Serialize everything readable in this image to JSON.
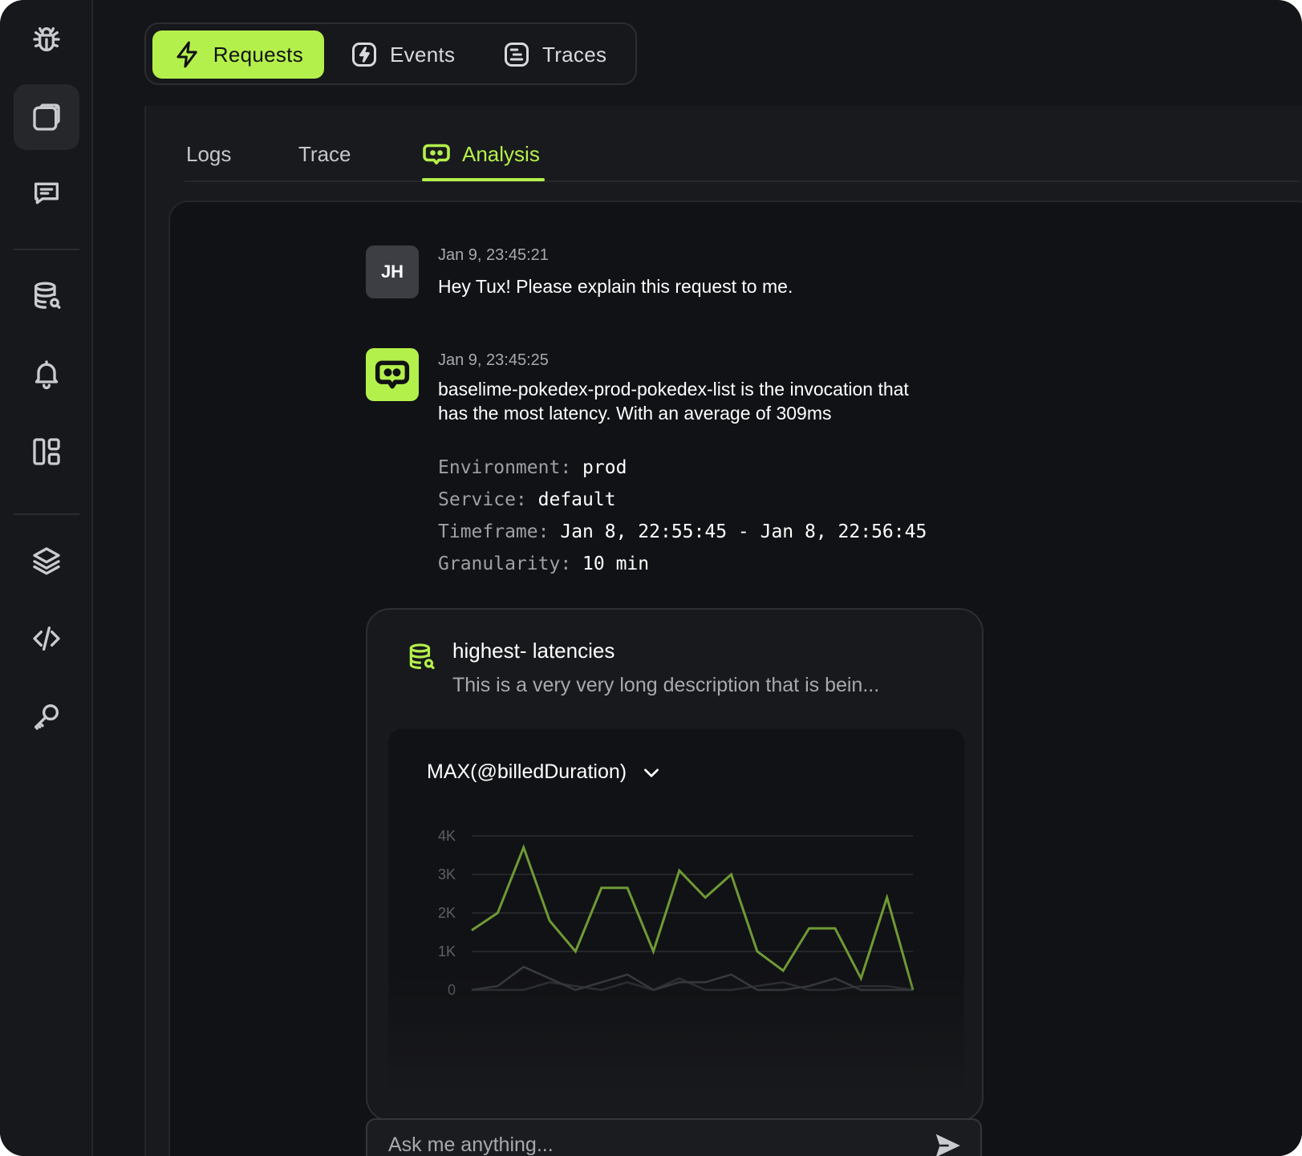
{
  "top_tabs": [
    {
      "label": "Requests",
      "icon": "lightning-icon",
      "active": true
    },
    {
      "label": "Events",
      "icon": "bolt-square-icon",
      "active": false
    },
    {
      "label": "Traces",
      "icon": "list-square-icon",
      "active": false
    }
  ],
  "sub_tabs": [
    {
      "label": "Logs",
      "active": false
    },
    {
      "label": "Trace",
      "active": false
    },
    {
      "label": "Analysis",
      "active": true,
      "icon": "bot-icon"
    }
  ],
  "sidebar": {
    "icons": [
      "bug-icon",
      "cube-icon",
      "chat-icon",
      "database-search-icon",
      "bell-icon",
      "dashboard-icon",
      "layers-icon",
      "code-icon",
      "key-icon"
    ]
  },
  "messages": [
    {
      "author": "user",
      "avatar_initials": "JH",
      "timestamp": "Jan 9, 23:45:21",
      "text": "Hey Tux! Please explain this request to me."
    },
    {
      "author": "bot",
      "timestamp": "Jan 9, 23:45:25",
      "text_line1": "baselime-pokedex-prod-pokedex-list is the invocation that",
      "text_line2": "has the most latency. With an average of 309ms"
    }
  ],
  "details": [
    {
      "key": "Environment:",
      "value": "prod"
    },
    {
      "key": "Service:",
      "value": "default"
    },
    {
      "key": "Timeframe:",
      "value": "Jan 8, 22:55:45 - Jan 8, 22:56:45"
    },
    {
      "key": "Granularity:",
      "value": "10 min"
    }
  ],
  "query": {
    "title": "highest- latencies",
    "description": "This is a very very long description that is bein...",
    "metric": "MAX(@billedDuration)"
  },
  "chart_data": {
    "type": "line",
    "title": "",
    "xlabel": "",
    "ylabel": "",
    "ylim": [
      0,
      4000
    ],
    "y_ticks": [
      "4K",
      "3K",
      "2K",
      "1K",
      "0"
    ],
    "y_tick_values": [
      4000,
      3000,
      2000,
      1000,
      0
    ],
    "x": [
      0,
      1,
      2,
      3,
      4,
      5,
      6,
      7,
      8,
      9,
      10,
      11,
      12,
      13,
      14,
      15,
      16,
      17
    ],
    "series": [
      {
        "color": "#6f9a35",
        "values": [
          1550,
          2000,
          3700,
          1800,
          1000,
          2650,
          2650,
          1000,
          3100,
          2400,
          3000,
          1000,
          500,
          1600,
          1600,
          300,
          2400,
          0
        ]
      },
      {
        "color": "#3a3c40",
        "values": [
          0,
          100,
          600,
          300,
          0,
          200,
          400,
          0,
          200,
          200,
          400,
          0,
          0,
          100,
          300,
          0,
          0,
          0
        ]
      },
      {
        "color": "#2f3134",
        "values": [
          0,
          0,
          0,
          200,
          100,
          0,
          200,
          0,
          300,
          0,
          0,
          100,
          200,
          0,
          0,
          100,
          100,
          0
        ]
      }
    ],
    "grid": true
  },
  "ask": {
    "placeholder": "Ask me anything..."
  },
  "colors": {
    "accent": "#b4f04c",
    "background": "#141518"
  }
}
